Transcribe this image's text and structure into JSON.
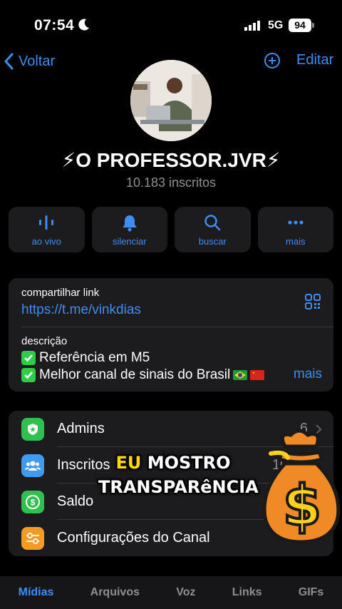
{
  "status_bar": {
    "time": "07:54",
    "network": "5G",
    "battery": "94",
    "moon_icon": "moon-icon",
    "signal_icon": "signal-icon"
  },
  "nav": {
    "back_label": "Voltar",
    "edit_label": "Editar",
    "add_icon": "add-circle-icon"
  },
  "channel": {
    "name": "⚡O PROFESSOR.JVR⚡",
    "subscribers": "10.183 inscritos"
  },
  "actions": [
    {
      "label": "ao vivo",
      "icon": "live-stream-icon"
    },
    {
      "label": "silenciar",
      "icon": "bell-icon"
    },
    {
      "label": "buscar",
      "icon": "search-icon"
    },
    {
      "label": "mais",
      "icon": "more-icon"
    }
  ],
  "info": {
    "share_label": "compartilhar link",
    "share_link": "https://t.me/vinkdias",
    "description_label": "descrição",
    "description_lines": [
      "Referência em M5",
      "Melhor canal de sinais do Brasil"
    ],
    "more_label": "mais"
  },
  "settings": [
    {
      "label": "Admins",
      "value": "6",
      "icon": "shield-icon",
      "color": "#30c04f"
    },
    {
      "label": "Inscritos",
      "value": "10.18",
      "icon": "people-icon",
      "color": "#3e9bf0"
    },
    {
      "label": "Saldo",
      "value": "",
      "icon": "dollar-icon",
      "color": "#30c04f"
    },
    {
      "label": "Configurações do Canal",
      "value": "",
      "icon": "sliders-icon",
      "color": "#f59a23"
    }
  ],
  "overlay": {
    "line1_highlight": "EU",
    "line1_rest": " MOSTRO",
    "line2": "TRANSPARêNCIA"
  },
  "tabs": [
    {
      "label": "Mídias",
      "active": true
    },
    {
      "label": "Arquivos",
      "active": false
    },
    {
      "label": "Voz",
      "active": false
    },
    {
      "label": "Links",
      "active": false
    },
    {
      "label": "GIFs",
      "active": false
    }
  ],
  "colors": {
    "accent": "#3e8df0",
    "background": "#000000",
    "card": "#1c1c1e",
    "overlay_highlight": "#ffd800",
    "money_bag": "#f08a24"
  }
}
